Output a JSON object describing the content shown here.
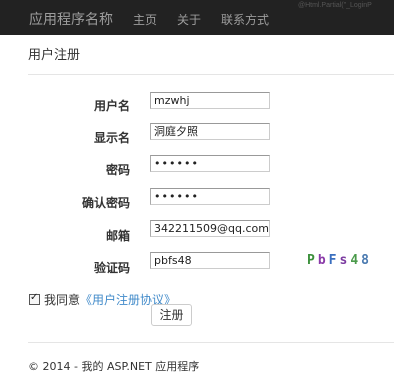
{
  "navbar": {
    "brand": "应用程序名称",
    "links": [
      "主页",
      "关于",
      "联系方式"
    ],
    "partial_text": "@Html.Partial(\"_LoginP"
  },
  "page_title": "用户注册",
  "form": {
    "username": {
      "label": "用户名",
      "value": "mzwhj"
    },
    "display_name": {
      "label": "显示名",
      "value": "洞庭夕照"
    },
    "password": {
      "label": "密码",
      "value": "••••••"
    },
    "confirm_password": {
      "label": "确认密码",
      "value": "••••••"
    },
    "email": {
      "label": "邮箱",
      "value": "342211509@qq.com"
    },
    "captcha": {
      "label": "验证码",
      "value": "pbfs48",
      "image_chars": [
        "P",
        "b",
        "F",
        "s",
        "4",
        "8"
      ],
      "image_colors": [
        "#3a8f3a",
        "#8a3aa8",
        "#3a6fbf",
        "#7b3aa0",
        "#4a9a4a",
        "#4a7ab0"
      ]
    }
  },
  "agreement": {
    "checked": true,
    "text": "我同意",
    "link_text": "《用户注册协议》"
  },
  "submit_label": "注册",
  "footer": "© 2014 - 我的 ASP.NET 应用程序"
}
